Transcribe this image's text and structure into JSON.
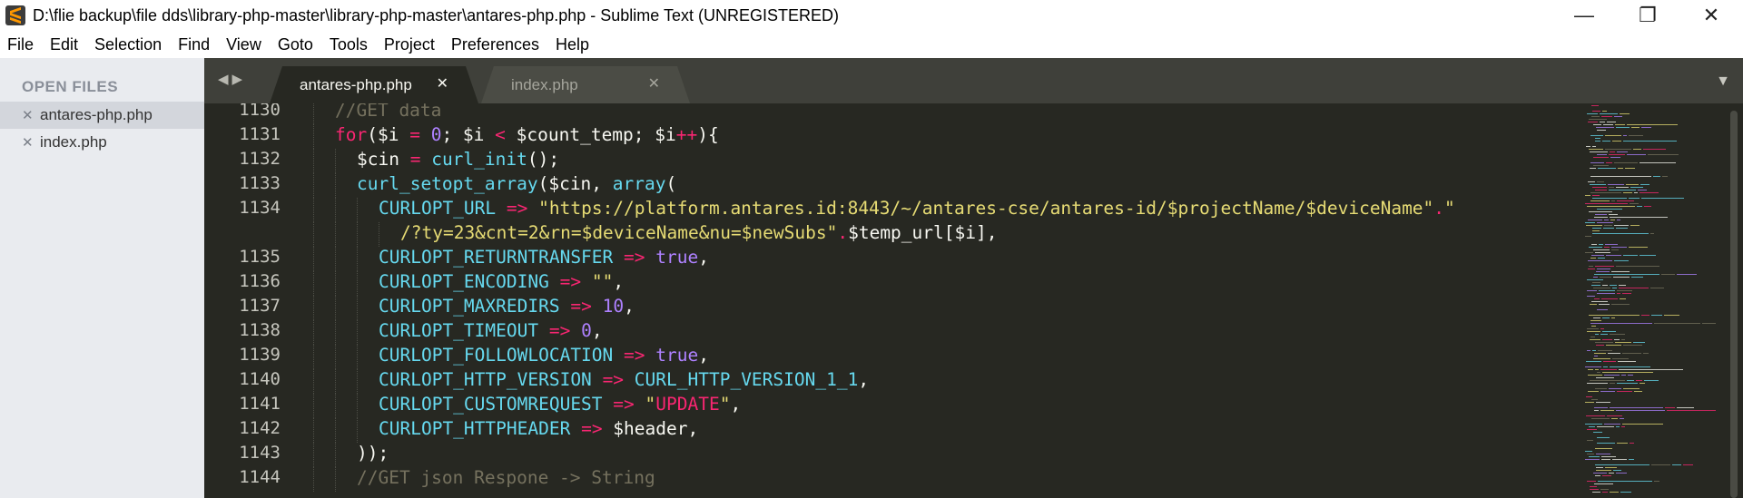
{
  "window": {
    "title": "D:\\flie backup\\file dds\\library-php-master\\library-php-master\\antares-php.php - Sublime Text (UNREGISTERED)",
    "minimize_glyph": "—",
    "maximize_glyph": "❐",
    "close_glyph": "✕"
  },
  "menu": [
    "File",
    "Edit",
    "Selection",
    "Find",
    "View",
    "Goto",
    "Tools",
    "Project",
    "Preferences",
    "Help"
  ],
  "sidebar": {
    "header": "OPEN FILES",
    "files": [
      {
        "name": "antares-php.php",
        "active": true
      },
      {
        "name": "index.php",
        "active": false
      }
    ],
    "close_glyph": "✕"
  },
  "tabs": [
    {
      "label": "antares-php.php",
      "active": true
    },
    {
      "label": "index.php",
      "active": false
    }
  ],
  "tab_close_glyph": "✕",
  "tab_nav_glyph": "◀▶",
  "tab_dropdown_glyph": "▼",
  "colors": {
    "background": "#272822",
    "keyword": "#f92672",
    "function": "#66d9ef",
    "number": "#ae81ff",
    "string": "#e6db74",
    "comment": "#75715e",
    "text": "#f8f8f2"
  },
  "editor": {
    "lines": [
      {
        "num": "1130",
        "indent": 3,
        "tokens": [
          [
            "c",
            "//GET data"
          ]
        ]
      },
      {
        "num": "1131",
        "indent": 3,
        "tokens": [
          [
            "k",
            "for"
          ],
          [
            "",
            "($i "
          ],
          [
            "k",
            "="
          ],
          [
            "",
            " "
          ],
          [
            "n",
            "0"
          ],
          [
            "",
            "; $i "
          ],
          [
            "k",
            "<"
          ],
          [
            "",
            " $count_temp; $i"
          ],
          [
            "k",
            "++"
          ],
          [
            "",
            "){"
          ]
        ]
      },
      {
        "num": "1132",
        "indent": 4,
        "tokens": [
          [
            "",
            "$cin "
          ],
          [
            "k",
            "="
          ],
          [
            "",
            " "
          ],
          [
            "fn",
            "curl_init"
          ],
          [
            "",
            "();"
          ]
        ]
      },
      {
        "num": "1133",
        "indent": 4,
        "tokens": [
          [
            "fn",
            "curl_setopt_array"
          ],
          [
            "",
            "($cin, "
          ],
          [
            "fn",
            "array"
          ],
          [
            "",
            "("
          ]
        ]
      },
      {
        "num": "1134",
        "indent": 5,
        "tokens": [
          [
            "cst",
            "CURLOPT_URL"
          ],
          [
            "",
            " "
          ],
          [
            "k",
            "=>"
          ],
          [
            "",
            " "
          ],
          [
            "s",
            "\"https://platform.antares.id:8443/~/antares-cse/antares-id/$projectName/$deviceName\""
          ],
          [
            "k",
            "."
          ],
          [
            "s",
            "\""
          ]
        ]
      },
      {
        "num": "",
        "indent": 6,
        "tokens": [
          [
            "s",
            "/?ty=23&cnt=2&rn=$deviceName&nu=$newSubs\""
          ],
          [
            "k",
            "."
          ],
          [
            "",
            "$temp_url[$i],"
          ]
        ]
      },
      {
        "num": "1135",
        "indent": 5,
        "tokens": [
          [
            "cst",
            "CURLOPT_RETURNTRANSFER"
          ],
          [
            "",
            " "
          ],
          [
            "k",
            "=>"
          ],
          [
            "",
            " "
          ],
          [
            "n",
            "true"
          ],
          [
            "",
            ","
          ]
        ]
      },
      {
        "num": "1136",
        "indent": 5,
        "tokens": [
          [
            "cst",
            "CURLOPT_ENCODING"
          ],
          [
            "",
            " "
          ],
          [
            "k",
            "=>"
          ],
          [
            "",
            " "
          ],
          [
            "s",
            "\"\""
          ],
          [
            "",
            ","
          ]
        ]
      },
      {
        "num": "1137",
        "indent": 5,
        "tokens": [
          [
            "cst",
            "CURLOPT_MAXREDIRS"
          ],
          [
            "",
            " "
          ],
          [
            "k",
            "=>"
          ],
          [
            "",
            " "
          ],
          [
            "n",
            "10"
          ],
          [
            "",
            ","
          ]
        ]
      },
      {
        "num": "1138",
        "indent": 5,
        "tokens": [
          [
            "cst",
            "CURLOPT_TIMEOUT"
          ],
          [
            "",
            " "
          ],
          [
            "k",
            "=>"
          ],
          [
            "",
            " "
          ],
          [
            "n",
            "0"
          ],
          [
            "",
            ","
          ]
        ]
      },
      {
        "num": "1139",
        "indent": 5,
        "tokens": [
          [
            "cst",
            "CURLOPT_FOLLOWLOCATION"
          ],
          [
            "",
            " "
          ],
          [
            "k",
            "=>"
          ],
          [
            "",
            " "
          ],
          [
            "n",
            "true"
          ],
          [
            "",
            ","
          ]
        ]
      },
      {
        "num": "1140",
        "indent": 5,
        "tokens": [
          [
            "cst",
            "CURLOPT_HTTP_VERSION"
          ],
          [
            "",
            " "
          ],
          [
            "k",
            "=>"
          ],
          [
            "",
            " "
          ],
          [
            "cst",
            "CURL_HTTP_VERSION_1_1"
          ],
          [
            "",
            ","
          ]
        ]
      },
      {
        "num": "1141",
        "indent": 5,
        "tokens": [
          [
            "cst",
            "CURLOPT_CUSTOMREQUEST"
          ],
          [
            "",
            " "
          ],
          [
            "k",
            "=>"
          ],
          [
            "",
            " "
          ],
          [
            "s",
            "\""
          ],
          [
            "k",
            "UPDATE"
          ],
          [
            "s",
            "\""
          ],
          [
            "",
            ","
          ]
        ]
      },
      {
        "num": "1142",
        "indent": 5,
        "tokens": [
          [
            "cst",
            "CURLOPT_HTTPHEADER"
          ],
          [
            "",
            " "
          ],
          [
            "k",
            "=>"
          ],
          [
            "",
            " $header,"
          ]
        ]
      },
      {
        "num": "1143",
        "indent": 4,
        "tokens": [
          [
            "",
            "));"
          ]
        ]
      },
      {
        "num": "1144",
        "indent": 4,
        "tokens": [
          [
            "c",
            "//GET json Respone -> String"
          ]
        ]
      }
    ]
  }
}
